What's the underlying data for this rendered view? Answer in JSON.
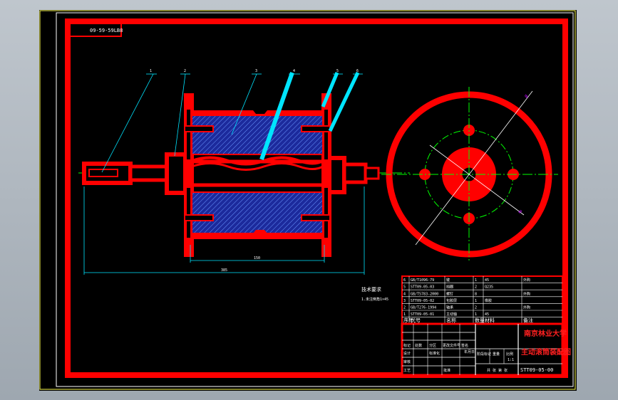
{
  "drawing_number_tag": "09-59-59LB8",
  "colors": {
    "frame": "#ff0000",
    "section_fill": "#1c2a9c",
    "hatch": "#5a8cff",
    "leader": "#00e5ff",
    "center_line": "#00ff00",
    "dimension": "#00e5ff",
    "background": "#000000"
  },
  "balloons": [
    "1",
    "2",
    "3",
    "4",
    "5",
    "6"
  ],
  "dimensions": {
    "inner_length": "150",
    "overall_length": "385"
  },
  "tech_requirements": {
    "heading": "技术要求",
    "line1": "1.未注倒角1×45"
  },
  "parts_list": [
    {
      "no": "6",
      "code": "GB/T1096-79",
      "name": "键",
      "qty": "1",
      "material": "45",
      "note": "外购"
    },
    {
      "no": "5",
      "code": "STT09-05-03",
      "name": "挡圈",
      "qty": "2",
      "material": "Q235",
      "note": ""
    },
    {
      "no": "4",
      "code": "GB/T5783-2000",
      "name": "螺钉",
      "qty": "8",
      "material": "",
      "note": "外购"
    },
    {
      "no": "3",
      "code": "STT09-05-02",
      "name": "包胶层",
      "qty": "1",
      "material": "橡胶",
      "note": ""
    },
    {
      "no": "2",
      "code": "GB/T276-1994",
      "name": "轴承",
      "qty": "2",
      "material": "",
      "note": "外购"
    },
    {
      "no": "1",
      "code": "STT09-05-01",
      "name": "主动轴",
      "qty": "1",
      "material": "45",
      "note": ""
    }
  ],
  "parts_header": {
    "no": "序号",
    "code": "代号",
    "name": "名称",
    "qty": "数量",
    "material": "材料",
    "note": "备注"
  },
  "title_block": {
    "school": "南京林业大学",
    "drawing_title": "主动滚筒装配图",
    "drawing_code": "STT09-05-00",
    "stage_label": "阶段标记",
    "weight_label": "重量",
    "scale_label": "比例",
    "scale_value": "1:1",
    "sheet_label": "共 张 第 张",
    "rows": [
      "标记",
      "处数",
      "分区",
      "更改文件号",
      "签名",
      "年月日"
    ],
    "roles": [
      "设计",
      "审核",
      "工艺",
      "批准"
    ],
    "std_label": "标准化"
  }
}
